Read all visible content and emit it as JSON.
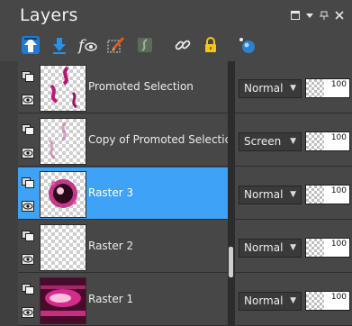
{
  "panel": {
    "title": "Layers"
  },
  "toolbar": {
    "icons": [
      "move-layer-up-icon",
      "move-layer-down-icon",
      "toggle-visibility-icon",
      "edit-selection-icon",
      "mask-icon",
      "link-icon",
      "lock-icon",
      "view-layer-icon"
    ]
  },
  "layers": [
    {
      "name": "Promoted Selection",
      "blend_mode": "Normal",
      "opacity": "100",
      "selected": false
    },
    {
      "name": "Copy of Promoted Selectic",
      "blend_mode": "Screen",
      "opacity": "100",
      "selected": false
    },
    {
      "name": "Raster 3",
      "blend_mode": "Normal",
      "opacity": "100",
      "selected": true
    },
    {
      "name": "Raster 2",
      "blend_mode": "Normal",
      "opacity": "100",
      "selected": false
    },
    {
      "name": "Raster 1",
      "blend_mode": "Normal",
      "opacity": "100",
      "selected": false
    }
  ],
  "colors": {
    "panel_bg": "#474747",
    "selected_row": "#3ea2f6",
    "accent_magenta": "#c0187c"
  }
}
